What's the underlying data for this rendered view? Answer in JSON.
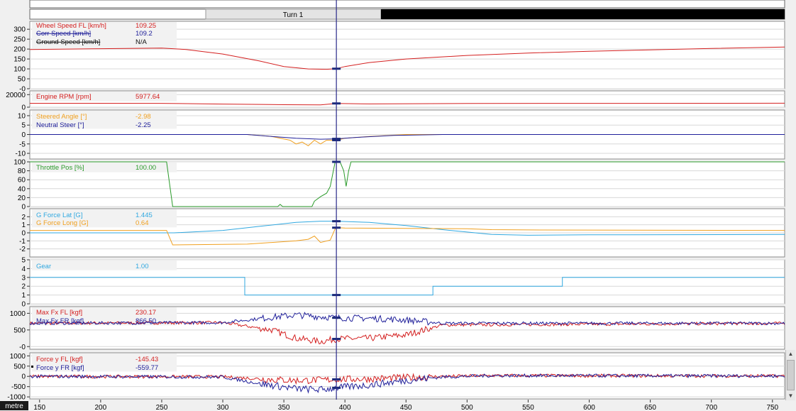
{
  "segments_bar": {
    "labels": [
      "Turn 1"
    ]
  },
  "cursor": {
    "distance": 393
  },
  "colors": {
    "red": "#d42020",
    "navy": "#20209a",
    "black": "#111111",
    "orange": "#f0a020",
    "green": "#2a9a2a",
    "cyan": "#30a8e0",
    "background": "#ffffff",
    "grid": "#d8d8d8"
  },
  "chart_data": {
    "type": "line",
    "x_unit_label": "metre",
    "x_ticks": [
      150,
      200,
      250,
      300,
      350,
      400,
      450,
      500,
      550,
      600,
      650,
      700,
      750
    ],
    "xlim": [
      142,
      760
    ],
    "panels": [
      {
        "id": "speed",
        "ylim": [
          0,
          340
        ],
        "y_ticks": [
          "300",
          "250",
          "200",
          "150",
          "100",
          "50",
          "-0"
        ],
        "y_tick_values": [
          300,
          250,
          200,
          150,
          100,
          50,
          0
        ],
        "series": [
          {
            "name": "Wheel Speed FL [km/h]",
            "value": "109.25",
            "color": "red",
            "x": [
              142,
              200,
              250,
              270,
              300,
              330,
              350,
              370,
              385,
              393,
              400,
              420,
              450,
              500,
              550,
              600,
              650,
              700,
              760
            ],
            "y": [
              198,
              202,
              205,
              198,
              175,
              140,
              112,
              100,
              98,
              101,
              112,
              132,
              150,
              168,
              180,
              189,
              196,
              203,
              210
            ]
          },
          {
            "name": "Corr Speed [km/h]",
            "value": "109.2",
            "color": "navy",
            "strike": true,
            "x": [],
            "y": []
          },
          {
            "name": "Ground Speed [km/h]",
            "value": "N/A",
            "color": "black",
            "strike": true,
            "x": [],
            "y": []
          }
        ]
      },
      {
        "id": "rpm",
        "ylim": [
          0,
          26000
        ],
        "y_ticks": [
          "20000",
          "0"
        ],
        "y_tick_values": [
          20000,
          0
        ],
        "series": [
          {
            "name": "Engine RPM [rpm]",
            "value": "5977.64",
            "color": "red",
            "x": [
              142,
              250,
              300,
              350,
              380,
              393,
              420,
              500,
              600,
              700,
              760
            ],
            "y": [
              6200,
              6100,
              5000,
              4000,
              3600,
              5978,
              5200,
              5900,
              6100,
              6200,
              6300
            ]
          }
        ]
      },
      {
        "id": "steer",
        "ylim": [
          -13,
          13
        ],
        "y_ticks": [
          "10",
          "5",
          "0",
          "-5",
          "-10"
        ],
        "y_tick_values": [
          10,
          5,
          0,
          -5,
          -10
        ],
        "series": [
          {
            "name": "Steered Angle [°]",
            "value": "-2.98",
            "color": "orange",
            "x": [
              142,
              320,
              340,
              355,
              360,
              365,
              370,
              375,
              380,
              385,
              393,
              400,
              420,
              450,
              500,
              760
            ],
            "y": [
              0,
              0,
              -1,
              -3,
              -5,
              -4,
              -6,
              -3,
              -5,
              -3,
              -3,
              -2,
              -1,
              0,
              0,
              0
            ]
          },
          {
            "name": "Neutral Steer [°]",
            "value": "-2.25",
            "color": "navy",
            "x": [
              142,
              320,
              340,
              360,
              380,
              393,
              410,
              440,
              480,
              760
            ],
            "y": [
              0,
              0,
              -1,
              -2,
              -2.5,
              -2.3,
              -1.5,
              -0.5,
              0,
              0
            ]
          }
        ]
      },
      {
        "id": "throttle",
        "ylim": [
          0,
          100
        ],
        "y_ticks": [
          "100",
          "80",
          "60",
          "40",
          "20",
          "0"
        ],
        "y_tick_values": [
          100,
          80,
          60,
          40,
          20,
          0
        ],
        "series": [
          {
            "name": "Throttle Pos [%]",
            "value": "100.00",
            "color": "green",
            "x": [
              142,
              254,
              259,
              345,
              347,
              349,
              373,
              375,
              380,
              385,
              388,
              392,
              396,
              399,
              401,
              403,
              405,
              760
            ],
            "y": [
              100,
              100,
              0,
              0,
              5,
              0,
              0,
              12,
              22,
              30,
              45,
              100,
              100,
              80,
              45,
              80,
              100,
              100
            ]
          }
        ]
      },
      {
        "id": "gforce",
        "ylim": [
          -3,
          3
        ],
        "y_ticks": [
          "2",
          "1",
          "0",
          "-1",
          "-2"
        ],
        "y_tick_values": [
          2,
          1,
          0,
          -1,
          -2
        ],
        "series": [
          {
            "name": "G Force Lat [G]",
            "value": "1.445",
            "color": "cyan",
            "x": [
              142,
              260,
              300,
              330,
              360,
              380,
              393,
              420,
              450,
              480,
              500,
              520,
              550,
              600,
              760
            ],
            "y": [
              0,
              0,
              0.3,
              0.8,
              1.3,
              1.45,
              1.445,
              1.3,
              0.9,
              0.4,
              0.1,
              -0.2,
              -0.3,
              -0.25,
              -0.2
            ]
          },
          {
            "name": "G Force Long [G]",
            "value": "0.64",
            "color": "orange",
            "x": [
              142,
              254,
              259,
              320,
              340,
              360,
              370,
              375,
              380,
              388,
              392,
              393,
              400,
              450,
              500,
              520,
              560,
              760
            ],
            "y": [
              0.3,
              0.3,
              -1.5,
              -1.4,
              -1.2,
              -1.0,
              -0.8,
              -0.4,
              -1.2,
              -0.9,
              0.5,
              0.64,
              0.6,
              0.55,
              0.5,
              0.4,
              0.35,
              0.3
            ]
          }
        ]
      },
      {
        "id": "gear",
        "ylim": [
          0,
          5
        ],
        "y_ticks": [
          "5",
          "4",
          "3",
          "2",
          "1",
          "0"
        ],
        "y_tick_values": [
          5,
          4,
          3,
          2,
          1,
          0
        ],
        "series": [
          {
            "name": "Gear",
            "value": "1.00",
            "color": "cyan",
            "step": true,
            "x": [
              142,
              318,
              318,
              472,
              472,
              578,
              578,
              760
            ],
            "y": [
              3,
              3,
              1,
              1,
              2,
              2,
              3,
              3
            ]
          }
        ]
      },
      {
        "id": "fx",
        "ylim": [
          -80,
          1200
        ],
        "y_ticks": [
          "1000",
          "500",
          "-0"
        ],
        "y_tick_values": [
          1000,
          500,
          0
        ],
        "series": [
          {
            "name": "Max Fx FL [kgf]",
            "value": "230.17",
            "color": "red",
            "noisy": true,
            "x": [
              142,
              300,
              340,
              360,
              380,
              393,
              420,
              450,
              480,
              760
            ],
            "y": [
              700,
              720,
              500,
              250,
              150,
              230,
              250,
              350,
              650,
              700
            ]
          },
          {
            "name": "Max Fx FR [kgf]",
            "value": "866.50",
            "color": "navy",
            "noisy": true,
            "x": [
              142,
              300,
              340,
              360,
              380,
              393,
              420,
              450,
              480,
              760
            ],
            "y": [
              700,
              720,
              880,
              950,
              900,
              866,
              850,
              800,
              700,
              700
            ]
          }
        ]
      },
      {
        "id": "fy",
        "ylim": [
          -1100,
          1150
        ],
        "y_ticks": [
          "1000",
          "500",
          "0",
          "-500",
          "-1000"
        ],
        "y_tick_values": [
          1000,
          500,
          0,
          -500,
          -1000
        ],
        "series": [
          {
            "name": "Force y FL [kgf]",
            "value": "-145.43",
            "color": "red",
            "noisy": true,
            "x": [
              142,
              300,
              340,
              360,
              380,
              393,
              420,
              450,
              480,
              520,
              760
            ],
            "y": [
              0,
              -20,
              -150,
              -200,
              -180,
              -145,
              -120,
              -60,
              0,
              40,
              20
            ]
          },
          {
            "name": "Force y FR [kgf]",
            "value": "-559.77",
            "color": "navy",
            "noisy": true,
            "x": [
              142,
              300,
              330,
              360,
              380,
              393,
              420,
              450,
              480,
              520,
              760
            ],
            "y": [
              0,
              -30,
              -350,
              -600,
              -650,
              -560,
              -420,
              -200,
              -30,
              40,
              20
            ]
          }
        ]
      }
    ]
  }
}
